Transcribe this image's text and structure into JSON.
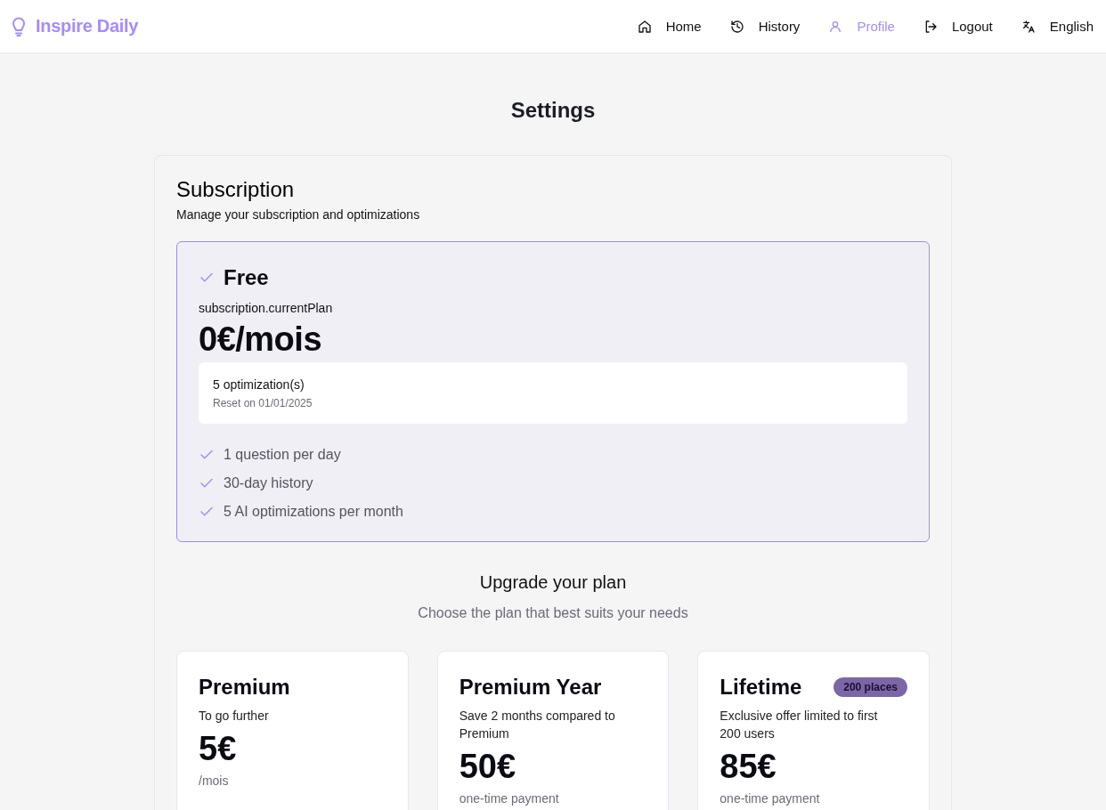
{
  "brand": {
    "name": "Inspire Daily"
  },
  "nav": [
    {
      "label": "Home",
      "kind": "home",
      "selected": false
    },
    {
      "label": "History",
      "kind": "history",
      "selected": false
    },
    {
      "label": "Profile",
      "kind": "user",
      "selected": true
    },
    {
      "label": "Logout",
      "kind": "logout",
      "selected": false
    },
    {
      "label": "English",
      "kind": "language",
      "selected": false
    }
  ],
  "page_title": "Settings",
  "subscription": {
    "title": "Subscription",
    "subtitle": "Manage your subscription and optimizations",
    "current_plan": {
      "name": "Free",
      "label": "subscription.currentPlan",
      "price": "0€/mois",
      "usage": {
        "count": "5 optimization(s)",
        "reset": "Reset on 01/01/2025"
      },
      "features": [
        "1 question per day",
        "30-day history",
        "5 AI optimizations per month"
      ]
    }
  },
  "upgrade": {
    "title": "Upgrade your plan",
    "subtitle": "Choose the plan that best suits your needs",
    "plans": [
      {
        "name": "Premium",
        "description": "To go further",
        "price": "5€",
        "period": "/mois"
      },
      {
        "name": "Premium Year",
        "description": "Save 2 months compared to Premium",
        "price": "50€",
        "period": "one-time payment"
      },
      {
        "name": "Lifetime",
        "badge": "200 places",
        "description": "Exclusive offer limited to first 200 users",
        "price": "85€",
        "period": "one-time payment"
      }
    ]
  }
}
